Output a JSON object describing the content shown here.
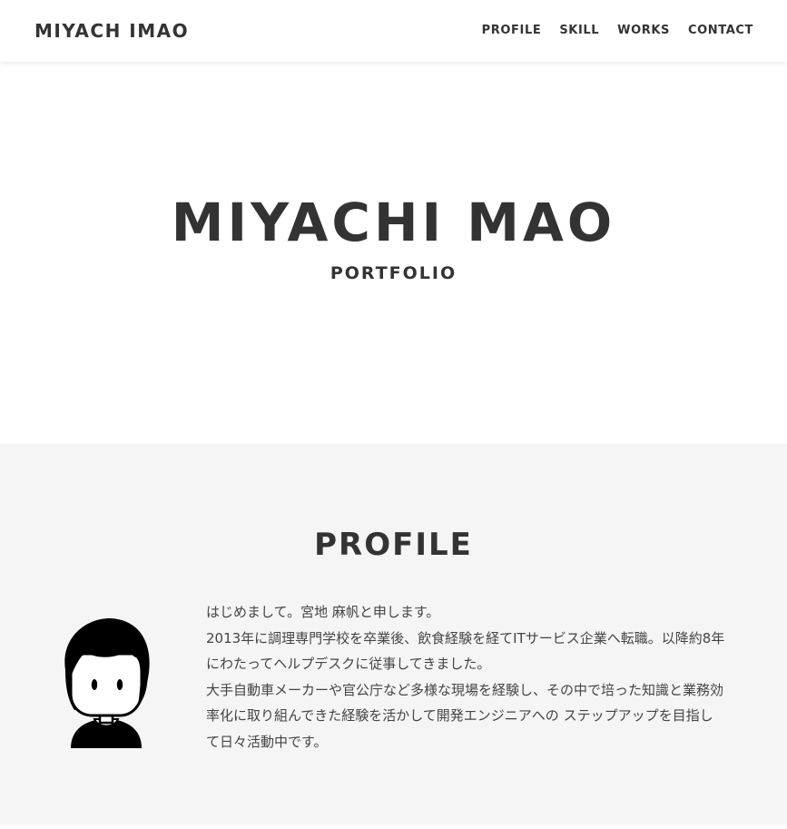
{
  "header": {
    "logo": "MIYACH IMAO",
    "nav": [
      "PROFILE",
      "SKILL",
      "WORKS",
      "CONTACT"
    ]
  },
  "hero": {
    "title": "MIYACHI MAO",
    "subtitle": "PORTFOLIO"
  },
  "profile": {
    "heading": "PROFILE",
    "avatar_icon": "person-avatar-icon",
    "bio_lines": [
      "はじめまして。宮地 麻帆と申します。",
      "2013年に調理専門学校を卒業後、飲食経験を経てITサービス企業へ転職。以降約8年",
      "にわたってヘルプデスクに従事してきました。",
      "大手自動車メーカーや官公庁など多様な現場を経験し、その中で培った知識と業務効",
      "率化に取り組んできた経験を活かして開発エンジニアへの ステップアップを目指し",
      "て日々活動中です。"
    ]
  },
  "colors": {
    "text": "#333333",
    "profile_bg": "#f5f5f5",
    "hero_bg": "#ffffff"
  }
}
